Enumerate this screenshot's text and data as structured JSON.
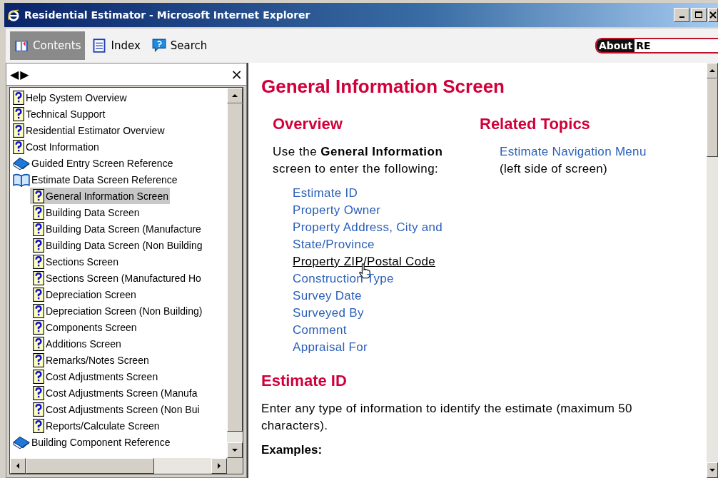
{
  "window": {
    "title": "Residential Estimator - Microsoft Internet Explorer"
  },
  "tabs": [
    {
      "label": "Contents",
      "selected": true
    },
    {
      "label": "Index",
      "selected": false
    },
    {
      "label": "Search",
      "selected": false
    }
  ],
  "logo": {
    "badge": "About",
    "text": "RE"
  },
  "nav_pane": {
    "back": "◀",
    "forward": "▶",
    "close": "×"
  },
  "tree": [
    {
      "kind": "page",
      "label": "Help System Overview",
      "selected": false
    },
    {
      "kind": "page",
      "label": "Technical Support",
      "selected": false
    },
    {
      "kind": "page",
      "label": "Residential Estimator Overview",
      "selected": false
    },
    {
      "kind": "page",
      "label": "Cost Information",
      "selected": false
    },
    {
      "kind": "book",
      "label": "Guided Entry Screen Reference",
      "selected": false,
      "expanded": false
    },
    {
      "kind": "book",
      "label": "Estimate Data Screen Reference",
      "selected": false,
      "expanded": true,
      "children": [
        {
          "kind": "page",
          "label": "General Information Screen",
          "selected": true
        },
        {
          "kind": "page",
          "label": "Building Data Screen",
          "selected": false
        },
        {
          "kind": "page",
          "label": "Building Data Screen (Manufacture",
          "selected": false
        },
        {
          "kind": "page",
          "label": "Building Data Screen (Non Building",
          "selected": false
        },
        {
          "kind": "page",
          "label": "Sections Screen",
          "selected": false
        },
        {
          "kind": "page",
          "label": "Sections Screen (Manufactured Ho",
          "selected": false
        },
        {
          "kind": "page",
          "label": "Depreciation Screen",
          "selected": false
        },
        {
          "kind": "page",
          "label": "Depreciation Screen (Non Building)",
          "selected": false
        },
        {
          "kind": "page",
          "label": "Components Screen",
          "selected": false
        },
        {
          "kind": "page",
          "label": "Additions Screen",
          "selected": false
        },
        {
          "kind": "page",
          "label": "Remarks/Notes Screen",
          "selected": false
        },
        {
          "kind": "page",
          "label": "Cost Adjustments Screen",
          "selected": false
        },
        {
          "kind": "page",
          "label": "Cost Adjustments Screen (Manufa",
          "selected": false
        },
        {
          "kind": "page",
          "label": "Cost Adjustments Screen (Non Bui",
          "selected": false
        },
        {
          "kind": "page",
          "label": "Reports/Calculate Screen",
          "selected": false
        }
      ]
    },
    {
      "kind": "book",
      "label": "Building Component Reference",
      "selected": false,
      "expanded": false
    }
  ],
  "content": {
    "title": "General Information Screen",
    "overview": {
      "heading": "Overview",
      "intro": "Use the **General Information** screen to enter the following:",
      "links": [
        {
          "label": "Estimate ID",
          "hovered": false
        },
        {
          "label": "Property Owner",
          "hovered": false
        },
        {
          "label": "Property Address, City and State/Province",
          "hovered": false
        },
        {
          "label": "Property ZIP/Postal Code",
          "hovered": true
        },
        {
          "label": "Construction Type",
          "hovered": false
        },
        {
          "label": "Survey Date",
          "hovered": false
        },
        {
          "label": "Surveyed By",
          "hovered": false
        },
        {
          "label": "Comment",
          "hovered": false
        },
        {
          "label": "Appraisal For",
          "hovered": false
        }
      ]
    },
    "related": {
      "heading": "Related Topics",
      "link": "Estimate Navigation Menu",
      "note": "(left side of screen)"
    },
    "section": {
      "heading": "Estimate ID",
      "text": "Enter any type of information to identify the estimate (maximum 50 characters).",
      "examples": "Examples:"
    }
  }
}
